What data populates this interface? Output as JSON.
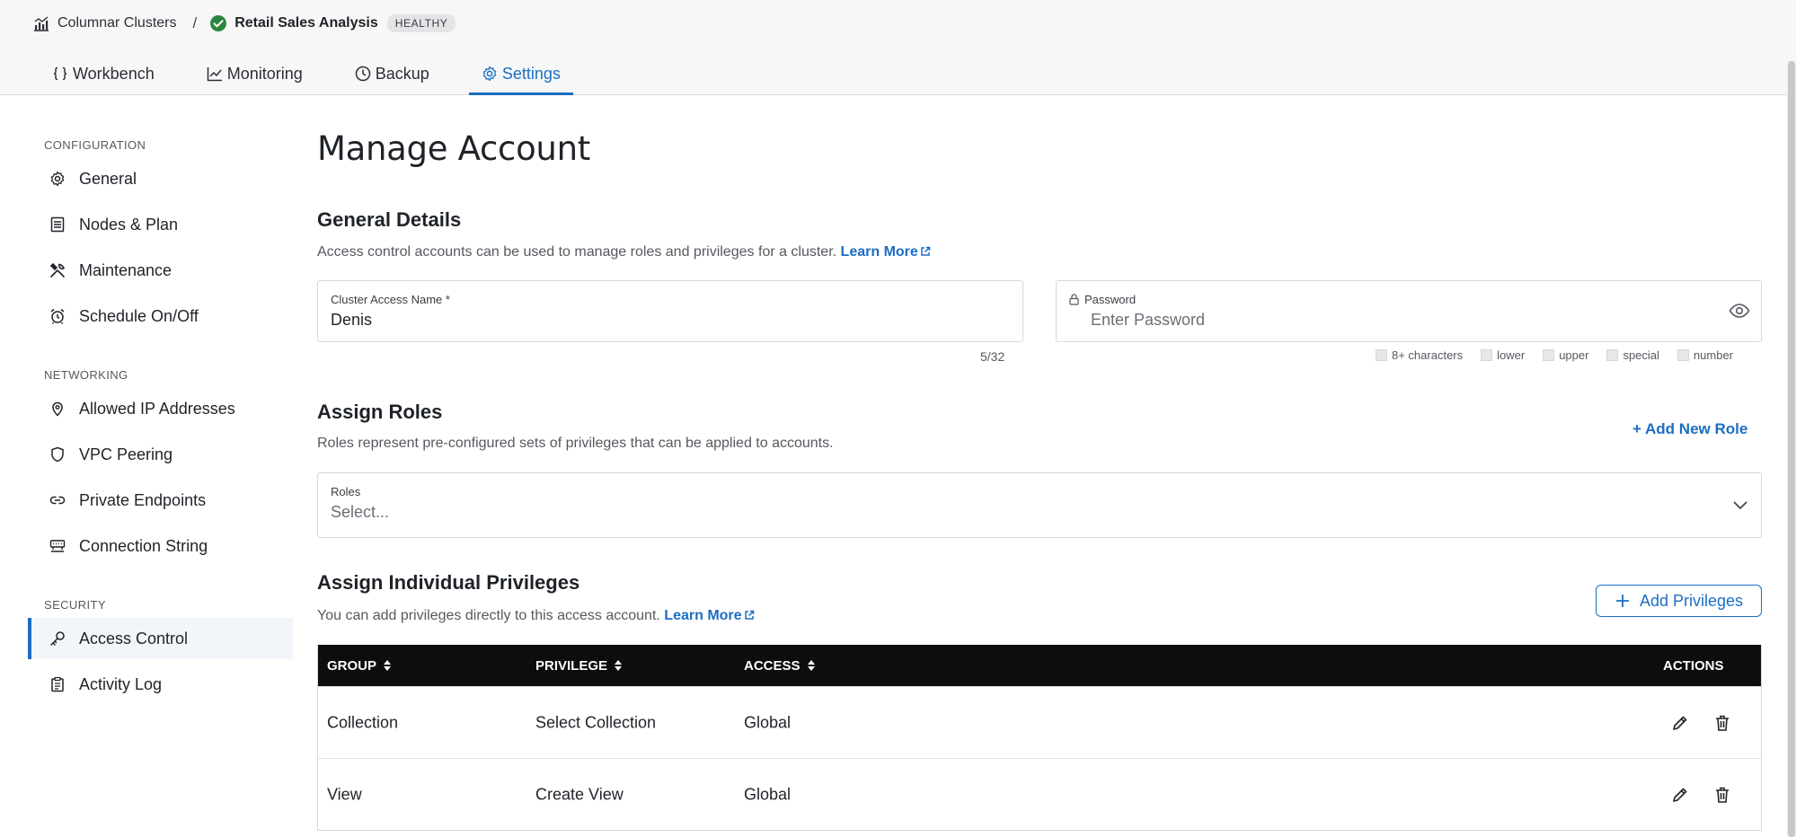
{
  "header": {
    "breadcrumb_root": "Columnar Clusters",
    "breadcrumb_separator": "/",
    "breadcrumb_current": "Retail Sales Analysis",
    "status_badge": "HEALTHY",
    "status_color": "#2e8540"
  },
  "tabs": [
    {
      "label": "Workbench",
      "icon": "braces-icon"
    },
    {
      "label": "Monitoring",
      "icon": "chart-line-icon"
    },
    {
      "label": "Backup",
      "icon": "clock-icon"
    },
    {
      "label": "Settings",
      "icon": "gear-icon",
      "active": true
    }
  ],
  "sidebar": {
    "sections": [
      {
        "title": "CONFIGURATION",
        "items": [
          {
            "label": "General",
            "icon": "gear-icon"
          },
          {
            "label": "Nodes & Plan",
            "icon": "list-icon"
          },
          {
            "label": "Maintenance",
            "icon": "tools-icon"
          },
          {
            "label": "Schedule On/Off",
            "icon": "alarm-icon"
          }
        ]
      },
      {
        "title": "NETWORKING",
        "items": [
          {
            "label": "Allowed IP Addresses",
            "icon": "location-pin-icon"
          },
          {
            "label": "VPC Peering",
            "icon": "shield-icon"
          },
          {
            "label": "Private Endpoints",
            "icon": "link-icon"
          },
          {
            "label": "Connection String",
            "icon": "connection-icon"
          }
        ]
      },
      {
        "title": "SECURITY",
        "items": [
          {
            "label": "Access Control",
            "icon": "key-icon",
            "active": true
          },
          {
            "label": "Activity Log",
            "icon": "clipboard-icon"
          }
        ]
      }
    ]
  },
  "main": {
    "title": "Manage Account",
    "general": {
      "title": "General Details",
      "description": "Access control accounts can be used to manage roles and privileges for a cluster.",
      "learn_more": "Learn More",
      "name_label": "Cluster Access Name *",
      "name_value": "Denis",
      "name_counter": "5/32",
      "password_label": "Password",
      "password_placeholder": "Enter Password",
      "password_rules": [
        "8+ characters",
        "lower",
        "upper",
        "special",
        "number"
      ]
    },
    "roles": {
      "title": "Assign Roles",
      "description": "Roles represent pre-configured sets of privileges that can be applied to accounts.",
      "add_button": "+ Add New Role",
      "select_label": "Roles",
      "select_placeholder": "Select..."
    },
    "privileges": {
      "title": "Assign Individual Privileges",
      "description": "You can add privileges directly to this access account.",
      "learn_more": "Learn More",
      "add_button": "Add Privileges",
      "columns": [
        "GROUP",
        "PRIVILEGE",
        "ACCESS",
        "ACTIONS"
      ],
      "rows": [
        {
          "group": "Collection",
          "privilege": "Select Collection",
          "access": "Global"
        },
        {
          "group": "View",
          "privilege": "Create View",
          "access": "Global"
        }
      ]
    }
  },
  "colors": {
    "accent": "#1b6ec2",
    "table_header": "#0d0d0d"
  }
}
